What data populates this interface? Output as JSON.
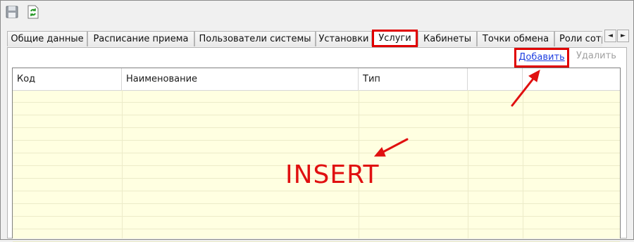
{
  "toolbar": {
    "buttons": [
      {
        "name": "save-icon"
      },
      {
        "name": "refresh-icon"
      }
    ]
  },
  "tabs": [
    {
      "label": "Общие данные",
      "active": false
    },
    {
      "label": "Расписание приема",
      "active": false
    },
    {
      "label": "Пользователи системы",
      "active": false
    },
    {
      "label": "Установки",
      "active": false
    },
    {
      "label": "Услуги",
      "active": true
    },
    {
      "label": "Кабинеты",
      "active": false
    },
    {
      "label": "Точки обмена",
      "active": false
    },
    {
      "label": "Роли сотр",
      "active": false
    }
  ],
  "tab_scroll": {
    "left": "◄",
    "right": "►"
  },
  "actions": {
    "add_label": "Добавить",
    "delete_label": "Удалить"
  },
  "grid": {
    "columns": [
      "Код",
      "Наименование",
      "Тип",
      "",
      ""
    ],
    "rows": []
  },
  "annotation": {
    "text": "INSERT"
  },
  "colors": {
    "highlight": "#e00000",
    "grid_background": "#ffffe1",
    "link": "#1f3fe0"
  }
}
